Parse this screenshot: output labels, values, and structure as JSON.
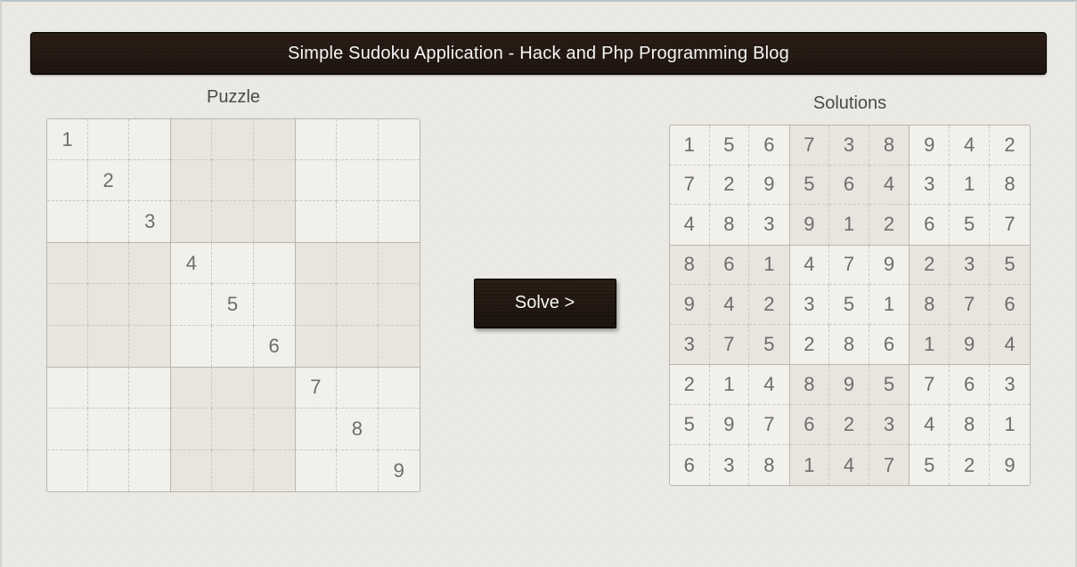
{
  "page_title": "Simple Sudoku Application - Hack and Php Programming Blog",
  "puzzle": {
    "title": "Puzzle",
    "cells": [
      [
        "1",
        "",
        "",
        "",
        "",
        "",
        "",
        "",
        ""
      ],
      [
        "",
        "2",
        "",
        "",
        "",
        "",
        "",
        "",
        ""
      ],
      [
        "",
        "",
        "3",
        "",
        "",
        "",
        "",
        "",
        ""
      ],
      [
        "",
        "",
        "",
        "4",
        "",
        "",
        "",
        "",
        ""
      ],
      [
        "",
        "",
        "",
        "",
        "5",
        "",
        "",
        "",
        ""
      ],
      [
        "",
        "",
        "",
        "",
        "",
        "6",
        "",
        "",
        ""
      ],
      [
        "",
        "",
        "",
        "",
        "",
        "",
        "7",
        "",
        ""
      ],
      [
        "",
        "",
        "",
        "",
        "",
        "",
        "",
        "8",
        ""
      ],
      [
        "",
        "",
        "",
        "",
        "",
        "",
        "",
        "",
        "9"
      ]
    ]
  },
  "solve_button_label": "Solve >",
  "solution": {
    "title": "Solutions",
    "cells": [
      [
        "1",
        "5",
        "6",
        "7",
        "3",
        "8",
        "9",
        "4",
        "2"
      ],
      [
        "7",
        "2",
        "9",
        "5",
        "6",
        "4",
        "3",
        "1",
        "8"
      ],
      [
        "4",
        "8",
        "3",
        "9",
        "1",
        "2",
        "6",
        "5",
        "7"
      ],
      [
        "8",
        "6",
        "1",
        "4",
        "7",
        "9",
        "2",
        "3",
        "5"
      ],
      [
        "9",
        "4",
        "2",
        "3",
        "5",
        "1",
        "8",
        "7",
        "6"
      ],
      [
        "3",
        "7",
        "5",
        "2",
        "8",
        "6",
        "1",
        "9",
        "4"
      ],
      [
        "2",
        "1",
        "4",
        "8",
        "9",
        "5",
        "7",
        "6",
        "3"
      ],
      [
        "5",
        "9",
        "7",
        "6",
        "2",
        "3",
        "4",
        "8",
        "1"
      ],
      [
        "6",
        "3",
        "8",
        "1",
        "4",
        "7",
        "5",
        "2",
        "9"
      ]
    ]
  }
}
